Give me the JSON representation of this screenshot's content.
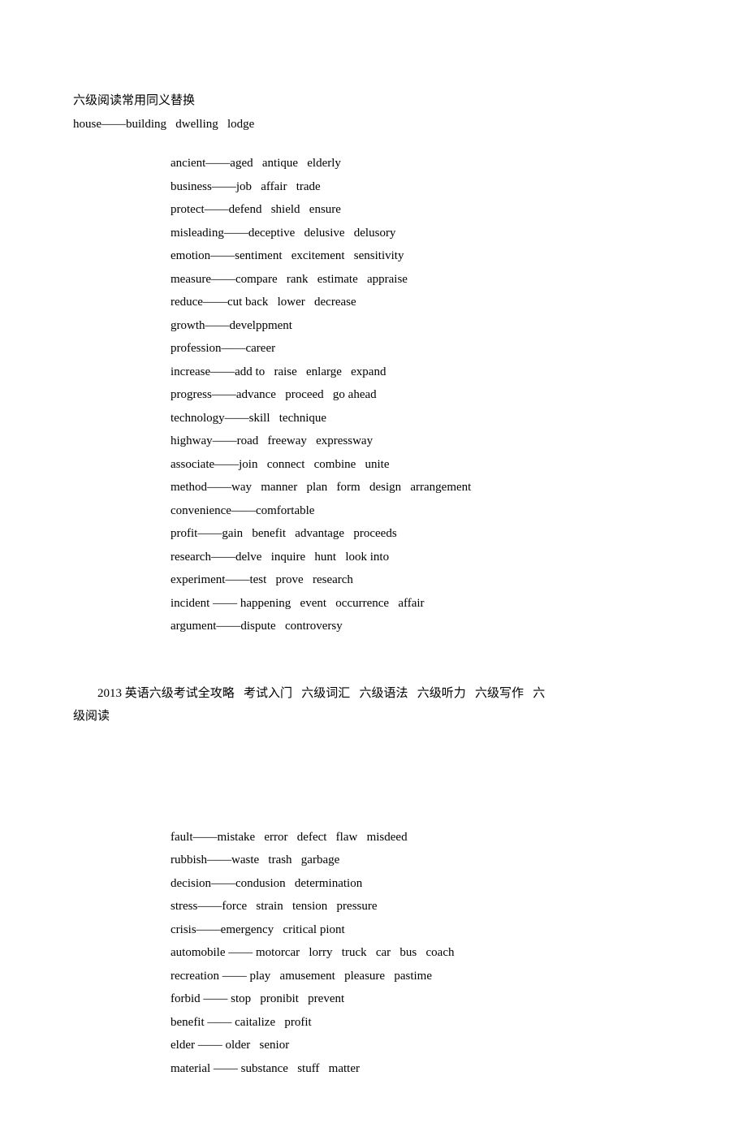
{
  "title": "六级阅读常用同义替换",
  "first_line": "house——building   dwelling   lodge",
  "block1": [
    "ancient——aged   antique   elderly",
    "business——job   affair   trade",
    "protect——defend   shield   ensure",
    "misleading——deceptive   delusive   delusory",
    "emotion——sentiment   excitement   sensitivity",
    "measure——compare   rank   estimate   appraise",
    "reduce——cut back   lower   decrease",
    "growth——develppment",
    "profession——career",
    "increase——add to   raise   enlarge   expand",
    "progress——advance   proceed   go ahead",
    "technology——skill   technique",
    "highway——road   freeway   expressway",
    "associate——join   connect   combine   unite",
    "method——way   manner   plan   form   design   arrangement",
    "convenience——comfortable",
    "profit——gain   benefit   advantage   proceeds",
    "research——delve   inquire   hunt   look into",
    "experiment——test   prove   research",
    "incident —— happening   event   occurrence   affair",
    "argument——dispute   controversy"
  ],
  "nav_line1": "2013 英语六级考试全攻略   考试入门   六级词汇   六级语法   六级听力   六级写作   六",
  "nav_line2": "级阅读",
  "block2": [
    "fault——mistake   error   defect   flaw   misdeed",
    "rubbish——waste   trash   garbage",
    "decision——condusion   determination",
    "stress——force   strain   tension   pressure",
    "crisis——emergency   critical piont",
    "automobile —— motorcar   lorry   truck   car   bus   coach",
    "recreation —— play   amusement   pleasure   pastime",
    "forbid —— stop   pronibit   prevent",
    "benefit —— caitalize   profit",
    "elder —— older   senior",
    "material —— substance   stuff   matter"
  ]
}
